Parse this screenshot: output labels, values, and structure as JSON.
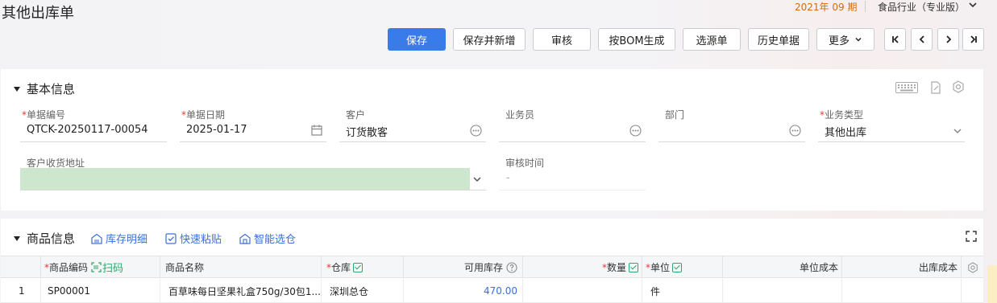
{
  "header": {
    "title": "其他出库单",
    "period": "2021年 09 期",
    "industry": "食品行业（专业版）"
  },
  "toolbar": {
    "save": "保存",
    "save_new": "保存并新增",
    "audit": "审核",
    "bom": "按BOM生成",
    "select_source": "选源单",
    "history": "历史单据",
    "more": "更多"
  },
  "basic": {
    "title": "基本信息",
    "doc_no_label": "单据编号",
    "doc_no": "QTCK-20250117-00054",
    "doc_date_label": "单据日期",
    "doc_date": "2025-01-17",
    "customer_label": "客户",
    "customer": "订货散客",
    "salesman_label": "业务员",
    "salesman": "",
    "dept_label": "部门",
    "dept": "",
    "biz_type_label": "业务类型",
    "biz_type": "其他出库",
    "address_label": "客户收货地址",
    "address": "",
    "audit_time_label": "审核时间",
    "audit_time": "-"
  },
  "goods": {
    "title": "商品信息",
    "stock_detail": "库存明细",
    "quick_paste": "快速粘贴",
    "smart_pick": "智能选仓",
    "scan": "扫码",
    "columns": {
      "code": "商品编码",
      "name": "商品名称",
      "warehouse": "仓库",
      "available": "可用库存",
      "qty": "数量",
      "unit": "单位",
      "unit_cost": "单位成本",
      "out_cost": "出库成本"
    },
    "rows": [
      {
        "index": "1",
        "code": "SP00001",
        "name": "百草味每日坚果礼盒750g/30包1...",
        "warehouse": "深圳总仓",
        "available": "470.00",
        "qty": "",
        "unit": "件",
        "unit_cost": "",
        "out_cost": ""
      }
    ]
  },
  "colors": {
    "primary": "#3a7bea",
    "period": "#d46b08",
    "link": "#3a6fd8",
    "required": "#e53935",
    "address_highlight": "#cde7cf"
  }
}
